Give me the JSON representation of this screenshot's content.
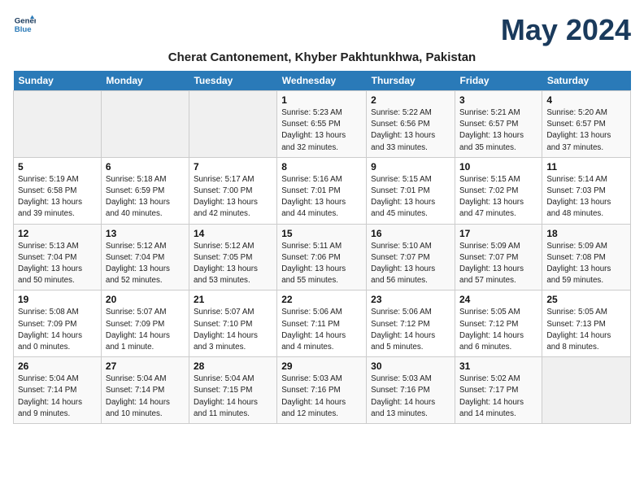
{
  "logo": {
    "line1": "General",
    "line2": "Blue"
  },
  "title": "May 2024",
  "subtitle": "Cherat Cantonement, Khyber Pakhtunkhwa, Pakistan",
  "days_of_week": [
    "Sunday",
    "Monday",
    "Tuesday",
    "Wednesday",
    "Thursday",
    "Friday",
    "Saturday"
  ],
  "weeks": [
    [
      {
        "day": "",
        "info": ""
      },
      {
        "day": "",
        "info": ""
      },
      {
        "day": "",
        "info": ""
      },
      {
        "day": "1",
        "info": "Sunrise: 5:23 AM\nSunset: 6:55 PM\nDaylight: 13 hours\nand 32 minutes."
      },
      {
        "day": "2",
        "info": "Sunrise: 5:22 AM\nSunset: 6:56 PM\nDaylight: 13 hours\nand 33 minutes."
      },
      {
        "day": "3",
        "info": "Sunrise: 5:21 AM\nSunset: 6:57 PM\nDaylight: 13 hours\nand 35 minutes."
      },
      {
        "day": "4",
        "info": "Sunrise: 5:20 AM\nSunset: 6:57 PM\nDaylight: 13 hours\nand 37 minutes."
      }
    ],
    [
      {
        "day": "5",
        "info": "Sunrise: 5:19 AM\nSunset: 6:58 PM\nDaylight: 13 hours\nand 39 minutes."
      },
      {
        "day": "6",
        "info": "Sunrise: 5:18 AM\nSunset: 6:59 PM\nDaylight: 13 hours\nand 40 minutes."
      },
      {
        "day": "7",
        "info": "Sunrise: 5:17 AM\nSunset: 7:00 PM\nDaylight: 13 hours\nand 42 minutes."
      },
      {
        "day": "8",
        "info": "Sunrise: 5:16 AM\nSunset: 7:01 PM\nDaylight: 13 hours\nand 44 minutes."
      },
      {
        "day": "9",
        "info": "Sunrise: 5:15 AM\nSunset: 7:01 PM\nDaylight: 13 hours\nand 45 minutes."
      },
      {
        "day": "10",
        "info": "Sunrise: 5:15 AM\nSunset: 7:02 PM\nDaylight: 13 hours\nand 47 minutes."
      },
      {
        "day": "11",
        "info": "Sunrise: 5:14 AM\nSunset: 7:03 PM\nDaylight: 13 hours\nand 48 minutes."
      }
    ],
    [
      {
        "day": "12",
        "info": "Sunrise: 5:13 AM\nSunset: 7:04 PM\nDaylight: 13 hours\nand 50 minutes."
      },
      {
        "day": "13",
        "info": "Sunrise: 5:12 AM\nSunset: 7:04 PM\nDaylight: 13 hours\nand 52 minutes."
      },
      {
        "day": "14",
        "info": "Sunrise: 5:12 AM\nSunset: 7:05 PM\nDaylight: 13 hours\nand 53 minutes."
      },
      {
        "day": "15",
        "info": "Sunrise: 5:11 AM\nSunset: 7:06 PM\nDaylight: 13 hours\nand 55 minutes."
      },
      {
        "day": "16",
        "info": "Sunrise: 5:10 AM\nSunset: 7:07 PM\nDaylight: 13 hours\nand 56 minutes."
      },
      {
        "day": "17",
        "info": "Sunrise: 5:09 AM\nSunset: 7:07 PM\nDaylight: 13 hours\nand 57 minutes."
      },
      {
        "day": "18",
        "info": "Sunrise: 5:09 AM\nSunset: 7:08 PM\nDaylight: 13 hours\nand 59 minutes."
      }
    ],
    [
      {
        "day": "19",
        "info": "Sunrise: 5:08 AM\nSunset: 7:09 PM\nDaylight: 14 hours\nand 0 minutes."
      },
      {
        "day": "20",
        "info": "Sunrise: 5:07 AM\nSunset: 7:09 PM\nDaylight: 14 hours\nand 1 minute."
      },
      {
        "day": "21",
        "info": "Sunrise: 5:07 AM\nSunset: 7:10 PM\nDaylight: 14 hours\nand 3 minutes."
      },
      {
        "day": "22",
        "info": "Sunrise: 5:06 AM\nSunset: 7:11 PM\nDaylight: 14 hours\nand 4 minutes."
      },
      {
        "day": "23",
        "info": "Sunrise: 5:06 AM\nSunset: 7:12 PM\nDaylight: 14 hours\nand 5 minutes."
      },
      {
        "day": "24",
        "info": "Sunrise: 5:05 AM\nSunset: 7:12 PM\nDaylight: 14 hours\nand 6 minutes."
      },
      {
        "day": "25",
        "info": "Sunrise: 5:05 AM\nSunset: 7:13 PM\nDaylight: 14 hours\nand 8 minutes."
      }
    ],
    [
      {
        "day": "26",
        "info": "Sunrise: 5:04 AM\nSunset: 7:14 PM\nDaylight: 14 hours\nand 9 minutes."
      },
      {
        "day": "27",
        "info": "Sunrise: 5:04 AM\nSunset: 7:14 PM\nDaylight: 14 hours\nand 10 minutes."
      },
      {
        "day": "28",
        "info": "Sunrise: 5:04 AM\nSunset: 7:15 PM\nDaylight: 14 hours\nand 11 minutes."
      },
      {
        "day": "29",
        "info": "Sunrise: 5:03 AM\nSunset: 7:16 PM\nDaylight: 14 hours\nand 12 minutes."
      },
      {
        "day": "30",
        "info": "Sunrise: 5:03 AM\nSunset: 7:16 PM\nDaylight: 14 hours\nand 13 minutes."
      },
      {
        "day": "31",
        "info": "Sunrise: 5:02 AM\nSunset: 7:17 PM\nDaylight: 14 hours\nand 14 minutes."
      },
      {
        "day": "",
        "info": ""
      }
    ]
  ]
}
